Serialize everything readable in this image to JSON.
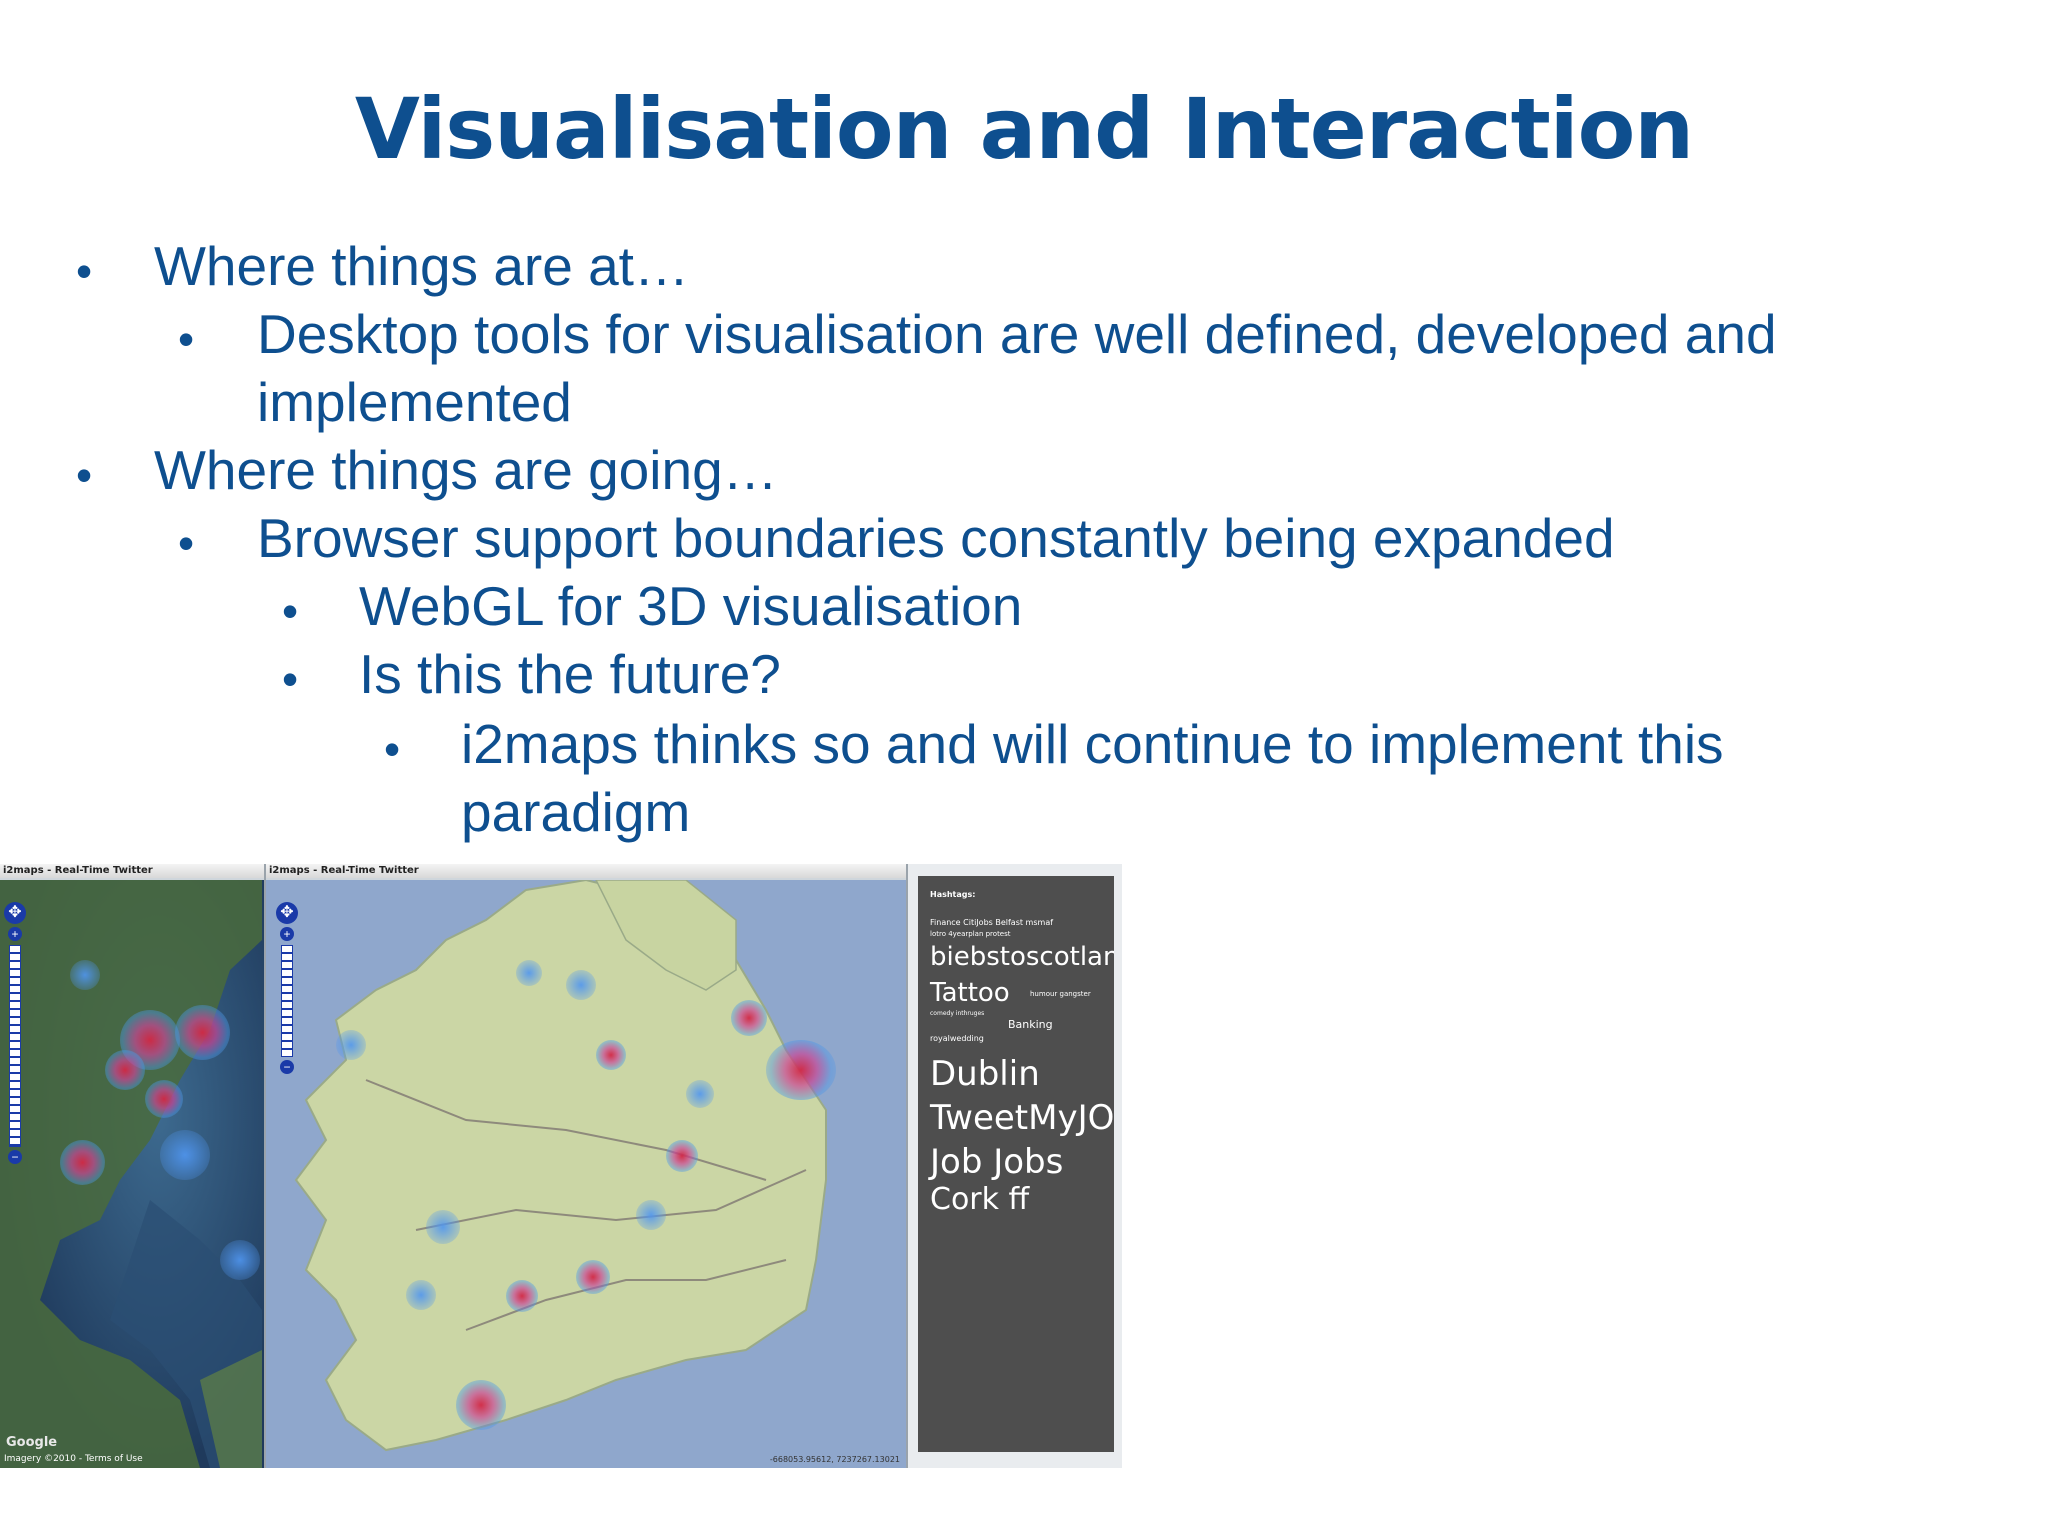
{
  "slide": {
    "title": "Visualisation and Interaction",
    "bullets": [
      {
        "level": 1,
        "text": "Where things are at…"
      },
      {
        "level": 2,
        "text": "Desktop tools for visualisation are well defined, developed and"
      },
      {
        "level": 2,
        "text": "implemented",
        "continuation": true
      },
      {
        "level": 1,
        "text": "Where things are going…"
      },
      {
        "level": 2,
        "text": "Browser support boundaries constantly being expanded"
      },
      {
        "level": 3,
        "text": "WebGL for 3D visualisation"
      },
      {
        "level": 3,
        "text": "Is this the future?"
      },
      {
        "level": 4,
        "text": "i2maps thinks so and will continue to implement this"
      },
      {
        "level": 4,
        "text": "paradigm",
        "continuation": true
      }
    ]
  },
  "screenshot": {
    "window1_title": "i2maps - Real-Time Twitter",
    "window2_title": "i2maps - Real-Time Twitter",
    "imagery_credit": "Imagery ©2010 - Terms of Use",
    "google_logo": "Google",
    "coords": "-668053.95612, 7237267.13021",
    "hashtag_panel": {
      "heading": "Hashtags:",
      "line1": "Finance  CitiJobs  Belfast  msmaf",
      "line2": "lotro  4yearplan  protest",
      "tag_biebs": "biebstoscotland",
      "tag_tattoo": "Tattoo",
      "tag_humour": "humour  gangster",
      "line3": "comedy  inthruges",
      "tag_banking": "Banking",
      "line4": "royalwedding",
      "tag_dublin": "Dublin",
      "tag_tweet": "TweetMyJOBS",
      "tag_job": "Job Jobs",
      "tag_cork": "Cork ff"
    }
  }
}
